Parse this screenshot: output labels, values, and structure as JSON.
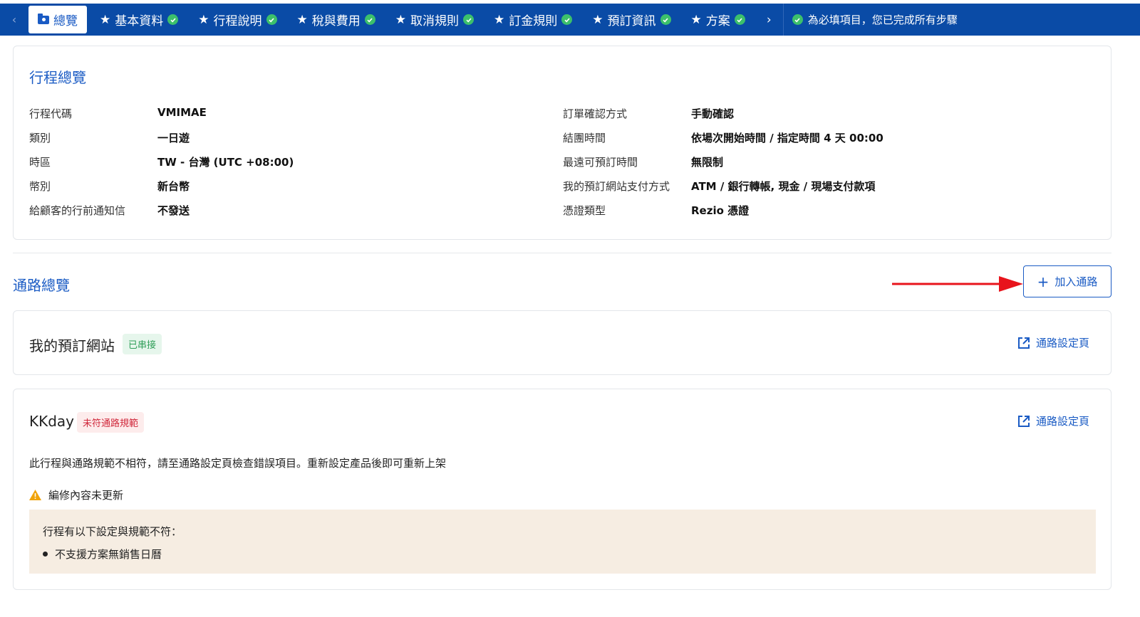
{
  "tabs": {
    "prev": "‹",
    "next": "›",
    "items": [
      {
        "label": "總覽",
        "active": true
      },
      {
        "label": "基本資料",
        "star": "★",
        "done": true
      },
      {
        "label": "行程說明",
        "star": "★",
        "done": true
      },
      {
        "label": "稅與費用",
        "star": "★",
        "done": true
      },
      {
        "label": "取消規則",
        "star": "★",
        "done": true
      },
      {
        "label": "訂金規則",
        "star": "★",
        "done": true
      },
      {
        "label": "預訂資訊",
        "star": "★",
        "done": true
      },
      {
        "label": "方案",
        "star": "★",
        "done": true
      }
    ],
    "done_note": "為必填項目，您已完成所有步驟"
  },
  "overview": {
    "title": "行程總覽",
    "left": [
      {
        "k": "行程代碼",
        "v": "VMIMAE"
      },
      {
        "k": "類別",
        "v": "一日遊"
      },
      {
        "k": "時區",
        "v": "TW - 台灣 (UTC +08:00)"
      },
      {
        "k": "幣別",
        "v": "新台幣"
      },
      {
        "k": "給顧客的行前通知信",
        "v": "不發送"
      }
    ],
    "right": [
      {
        "k": "訂單確認方式",
        "v": "手動確認"
      },
      {
        "k": "結團時間",
        "v": "依場次開始時間 / 指定時間 4 天 00:00"
      },
      {
        "k": "最遠可預訂時間",
        "v": "無限制"
      },
      {
        "k": "我的預訂網站支付方式",
        "v": "ATM / 銀行轉帳, 現金 / 現場支付款項"
      },
      {
        "k": "憑證類型",
        "v": "Rezio 憑證"
      }
    ]
  },
  "channels": {
    "title": "通路總覽",
    "add_label": "加入通路",
    "add_icon": "+",
    "items": [
      {
        "name": "我的預訂網站",
        "badge": "已串接",
        "link": "通路設定頁"
      },
      {
        "name": "KKday",
        "badge": "未符通路規範",
        "link": "通路設定頁",
        "desc": "此行程與通路規範不相符，請至通路設定頁檢查錯誤項目。重新設定產品後即可重新上架",
        "warning": "編修內容未更新",
        "notice_title": "行程有以下設定與規範不符：",
        "notice_items": [
          "不支援方案無銷售日曆"
        ]
      }
    ]
  },
  "colors": {
    "tabbar": "#0a4ba6",
    "accent": "#1a5bc4",
    "success": "#3cc06b",
    "error": "#d0283b",
    "arrow": "#e8141c"
  },
  "icons": [
    "folder-icon",
    "star-icon",
    "check-circle-icon",
    "plus-icon",
    "external-link-icon",
    "warning-icon",
    "arrow-annotation"
  ]
}
